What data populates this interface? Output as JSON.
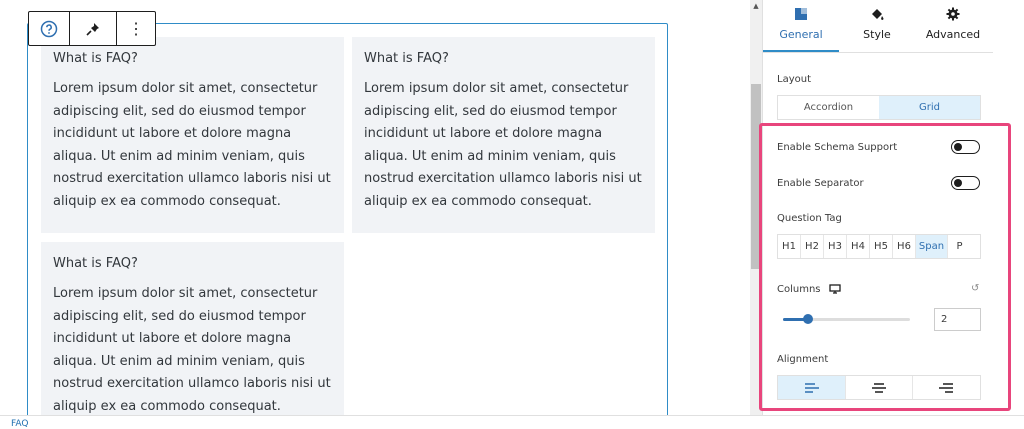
{
  "faq": {
    "items": [
      {
        "question": "What is FAQ?",
        "answer": "Lorem ipsum dolor sit amet, consectetur adipiscing elit, sed do eiusmod tempor incididunt ut labore et dolore magna aliqua. Ut enim ad minim veniam, quis nostrud exercitation ullamco laboris nisi ut aliquip ex ea commodo consequat."
      },
      {
        "question": "What is FAQ?",
        "answer": "Lorem ipsum dolor sit amet, consectetur adipiscing elit, sed do eiusmod tempor incididunt ut labore et dolore magna aliqua. Ut enim ad minim veniam, quis nostrud exercitation ullamco laboris nisi ut aliquip ex ea commodo consequat."
      },
      {
        "question": "What is FAQ?",
        "answer": "Lorem ipsum dolor sit amet, consectetur adipiscing elit, sed do eiusmod tempor incididunt ut labore et dolore magna aliqua. Ut enim ad minim veniam, quis nostrud exercitation ullamco laboris nisi ut aliquip ex ea commodo consequat."
      }
    ]
  },
  "toolbar": {
    "more_label": "⋮"
  },
  "footer": {
    "breadcrumb": "FAQ"
  },
  "sidebar": {
    "tabs": [
      {
        "label": "General",
        "active": true
      },
      {
        "label": "Style",
        "active": false
      },
      {
        "label": "Advanced",
        "active": false
      }
    ],
    "layout": {
      "label": "Layout",
      "options": [
        "Accordion",
        "Grid"
      ],
      "selected": "Grid"
    },
    "schema_support": {
      "label": "Enable Schema Support",
      "enabled": false
    },
    "separator": {
      "label": "Enable Separator",
      "enabled": false
    },
    "question_tag": {
      "label": "Question Tag",
      "options": [
        "H1",
        "H2",
        "H3",
        "H4",
        "H5",
        "H6",
        "Span",
        "P"
      ],
      "selected": "Span"
    },
    "columns": {
      "label": "Columns",
      "value": "2",
      "reset_icon": "↺"
    },
    "alignment": {
      "label": "Alignment",
      "options": [
        "left",
        "center",
        "right"
      ],
      "selected": "left"
    }
  },
  "colors": {
    "accent": "#2f6fb0",
    "highlight": "#e8457c",
    "card_bg": "#f1f3f6"
  }
}
